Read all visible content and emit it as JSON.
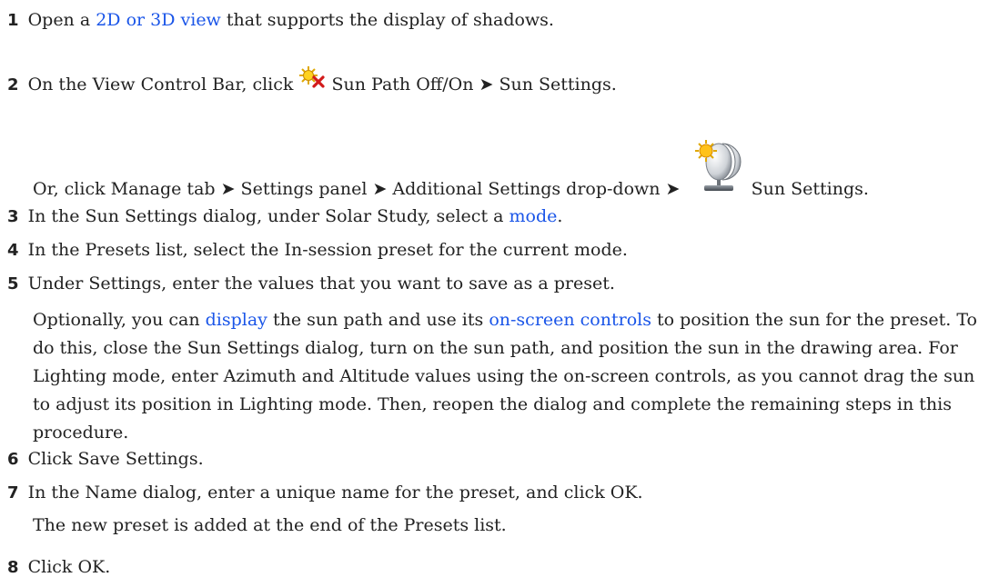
{
  "steps": {
    "s1": {
      "num": "1",
      "pre": "Open a",
      "link": "2D or 3D view",
      "post": "that supports the display of shadows."
    },
    "s2": {
      "num": "2",
      "pre": "On the View Control Bar, click",
      "icon": "sun-path-off-icon",
      "post": "Sun Path Off/On ➤ Sun Settings."
    },
    "s2_alt": {
      "pre": "Or, click Manage tab ➤ Settings panel ➤ Additional Settings drop-down ➤",
      "icon": "sun-settings-icon",
      "post": "Sun Settings."
    },
    "s3": {
      "num": "3",
      "pre": "In the Sun Settings dialog, under Solar Study, select a",
      "link": "mode",
      "post": "."
    },
    "s4": {
      "num": "4",
      "text": "In the Presets list, select the In-session preset for the current mode."
    },
    "s5": {
      "num": "5",
      "text": "Under Settings, enter the values that you want to save as a preset."
    },
    "s5_note": {
      "pre": "Optionally, you can",
      "link1": "display",
      "mid": "the sun path and use its",
      "link2": "on-screen controls",
      "post": "to position the sun for the preset. To do this, close the Sun Settings dialog, turn on the sun path, and position the sun in the drawing area. For Lighting mode, enter Azimuth and Altitude values using the on-screen controls, as you cannot drag the sun to adjust its position in Lighting mode. Then, reopen the dialog and complete the remaining steps in this procedure."
    },
    "s6": {
      "num": "6",
      "text": "Click Save Settings."
    },
    "s7": {
      "num": "7",
      "text": "In the Name dialog, enter a unique name for the preset, and click OK."
    },
    "s7_note": {
      "text": "The new preset is added at the end of the Presets list."
    },
    "s8": {
      "num": "8",
      "text": "Click OK."
    }
  },
  "colors": {
    "link": "#1a55e8",
    "text": "#222222"
  }
}
